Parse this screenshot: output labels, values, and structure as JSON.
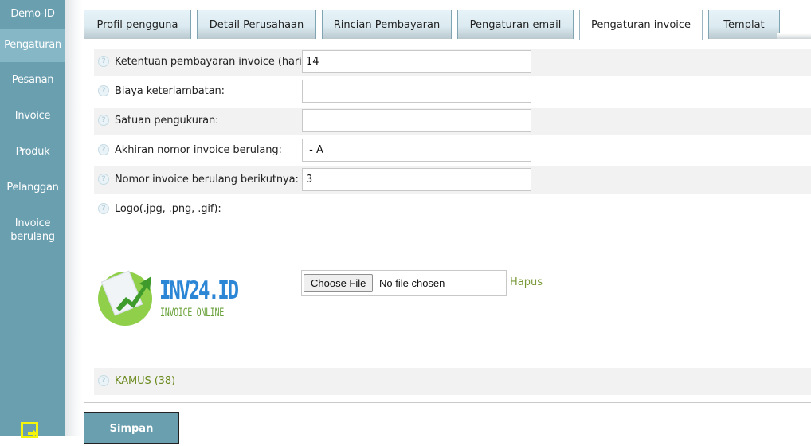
{
  "sidebar": {
    "brand": "Demo-ID",
    "items": [
      {
        "label": "Pengaturan",
        "active": true
      },
      {
        "label": "Pesanan"
      },
      {
        "label": "Invoice"
      },
      {
        "label": "Produk"
      },
      {
        "label": "Pelanggan"
      },
      {
        "label": "Invoice berulang"
      }
    ],
    "logout_icon": "logout-icon"
  },
  "tabs": [
    {
      "label": "Profil pengguna"
    },
    {
      "label": "Detail Perusahaan"
    },
    {
      "label": "Rincian Pembayaran"
    },
    {
      "label": "Pengaturan email"
    },
    {
      "label": "Pengaturan invoice",
      "active": true
    },
    {
      "label": "Templat"
    }
  ],
  "form": {
    "fields": [
      {
        "label": "Ketentuan pembayaran invoice (hari):",
        "value": "14"
      },
      {
        "label": "Biaya keterlambatan:",
        "value": ""
      },
      {
        "label": "Satuan pengukuran:",
        "value": ""
      },
      {
        "label": "Akhiran nomor invoice berulang:",
        "value": " - A"
      },
      {
        "label": "Nomor invoice berulang berikutnya:",
        "value": "3"
      }
    ],
    "logo": {
      "label": "Logo(.jpg, .png, .gif):",
      "brand_text": "INV24.ID",
      "sub_text": "INVOICE ONLINE",
      "choose_file": "Choose File",
      "no_file": "No file chosen",
      "remove": "Hapus"
    },
    "kamus_link": "KAMUS (38)",
    "help_glyph": "?"
  },
  "actions": {
    "save": "Simpan"
  },
  "colors": {
    "sidebar": "#6a9fb0",
    "sidebar_active": "#86b7c6",
    "link": "#6b8a1e",
    "logo_blue": "#2c86d6",
    "logo_green": "#8fcf4a"
  }
}
